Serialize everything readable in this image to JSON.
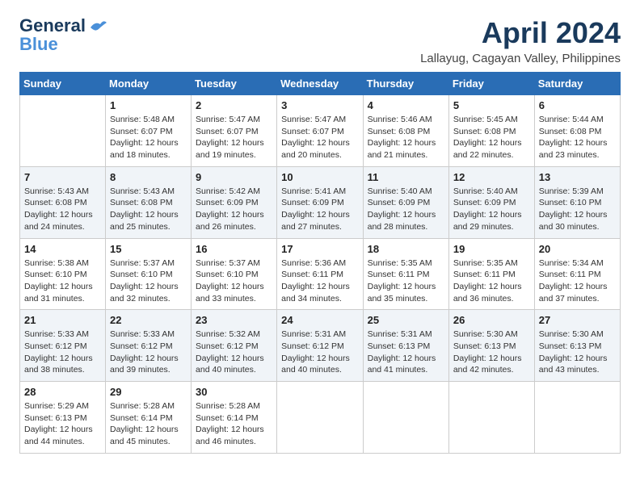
{
  "header": {
    "logo_line1": "General",
    "logo_line2": "Blue",
    "title": "April 2024",
    "subtitle": "Lallayug, Cagayan Valley, Philippines"
  },
  "weekdays": [
    "Sunday",
    "Monday",
    "Tuesday",
    "Wednesday",
    "Thursday",
    "Friday",
    "Saturday"
  ],
  "weeks": [
    [
      {
        "day": "",
        "info": ""
      },
      {
        "day": "1",
        "info": "Sunrise: 5:48 AM\nSunset: 6:07 PM\nDaylight: 12 hours\nand 18 minutes."
      },
      {
        "day": "2",
        "info": "Sunrise: 5:47 AM\nSunset: 6:07 PM\nDaylight: 12 hours\nand 19 minutes."
      },
      {
        "day": "3",
        "info": "Sunrise: 5:47 AM\nSunset: 6:07 PM\nDaylight: 12 hours\nand 20 minutes."
      },
      {
        "day": "4",
        "info": "Sunrise: 5:46 AM\nSunset: 6:08 PM\nDaylight: 12 hours\nand 21 minutes."
      },
      {
        "day": "5",
        "info": "Sunrise: 5:45 AM\nSunset: 6:08 PM\nDaylight: 12 hours\nand 22 minutes."
      },
      {
        "day": "6",
        "info": "Sunrise: 5:44 AM\nSunset: 6:08 PM\nDaylight: 12 hours\nand 23 minutes."
      }
    ],
    [
      {
        "day": "7",
        "info": "Sunrise: 5:43 AM\nSunset: 6:08 PM\nDaylight: 12 hours\nand 24 minutes."
      },
      {
        "day": "8",
        "info": "Sunrise: 5:43 AM\nSunset: 6:08 PM\nDaylight: 12 hours\nand 25 minutes."
      },
      {
        "day": "9",
        "info": "Sunrise: 5:42 AM\nSunset: 6:09 PM\nDaylight: 12 hours\nand 26 minutes."
      },
      {
        "day": "10",
        "info": "Sunrise: 5:41 AM\nSunset: 6:09 PM\nDaylight: 12 hours\nand 27 minutes."
      },
      {
        "day": "11",
        "info": "Sunrise: 5:40 AM\nSunset: 6:09 PM\nDaylight: 12 hours\nand 28 minutes."
      },
      {
        "day": "12",
        "info": "Sunrise: 5:40 AM\nSunset: 6:09 PM\nDaylight: 12 hours\nand 29 minutes."
      },
      {
        "day": "13",
        "info": "Sunrise: 5:39 AM\nSunset: 6:10 PM\nDaylight: 12 hours\nand 30 minutes."
      }
    ],
    [
      {
        "day": "14",
        "info": "Sunrise: 5:38 AM\nSunset: 6:10 PM\nDaylight: 12 hours\nand 31 minutes."
      },
      {
        "day": "15",
        "info": "Sunrise: 5:37 AM\nSunset: 6:10 PM\nDaylight: 12 hours\nand 32 minutes."
      },
      {
        "day": "16",
        "info": "Sunrise: 5:37 AM\nSunset: 6:10 PM\nDaylight: 12 hours\nand 33 minutes."
      },
      {
        "day": "17",
        "info": "Sunrise: 5:36 AM\nSunset: 6:11 PM\nDaylight: 12 hours\nand 34 minutes."
      },
      {
        "day": "18",
        "info": "Sunrise: 5:35 AM\nSunset: 6:11 PM\nDaylight: 12 hours\nand 35 minutes."
      },
      {
        "day": "19",
        "info": "Sunrise: 5:35 AM\nSunset: 6:11 PM\nDaylight: 12 hours\nand 36 minutes."
      },
      {
        "day": "20",
        "info": "Sunrise: 5:34 AM\nSunset: 6:11 PM\nDaylight: 12 hours\nand 37 minutes."
      }
    ],
    [
      {
        "day": "21",
        "info": "Sunrise: 5:33 AM\nSunset: 6:12 PM\nDaylight: 12 hours\nand 38 minutes."
      },
      {
        "day": "22",
        "info": "Sunrise: 5:33 AM\nSunset: 6:12 PM\nDaylight: 12 hours\nand 39 minutes."
      },
      {
        "day": "23",
        "info": "Sunrise: 5:32 AM\nSunset: 6:12 PM\nDaylight: 12 hours\nand 40 minutes."
      },
      {
        "day": "24",
        "info": "Sunrise: 5:31 AM\nSunset: 6:12 PM\nDaylight: 12 hours\nand 40 minutes."
      },
      {
        "day": "25",
        "info": "Sunrise: 5:31 AM\nSunset: 6:13 PM\nDaylight: 12 hours\nand 41 minutes."
      },
      {
        "day": "26",
        "info": "Sunrise: 5:30 AM\nSunset: 6:13 PM\nDaylight: 12 hours\nand 42 minutes."
      },
      {
        "day": "27",
        "info": "Sunrise: 5:30 AM\nSunset: 6:13 PM\nDaylight: 12 hours\nand 43 minutes."
      }
    ],
    [
      {
        "day": "28",
        "info": "Sunrise: 5:29 AM\nSunset: 6:13 PM\nDaylight: 12 hours\nand 44 minutes."
      },
      {
        "day": "29",
        "info": "Sunrise: 5:28 AM\nSunset: 6:14 PM\nDaylight: 12 hours\nand 45 minutes."
      },
      {
        "day": "30",
        "info": "Sunrise: 5:28 AM\nSunset: 6:14 PM\nDaylight: 12 hours\nand 46 minutes."
      },
      {
        "day": "",
        "info": ""
      },
      {
        "day": "",
        "info": ""
      },
      {
        "day": "",
        "info": ""
      },
      {
        "day": "",
        "info": ""
      }
    ]
  ]
}
